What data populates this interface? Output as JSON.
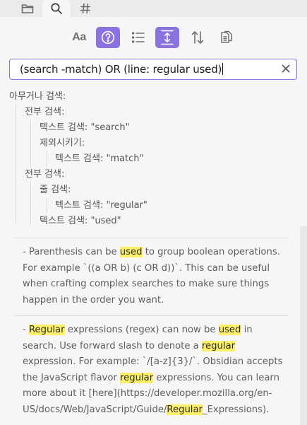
{
  "tabs": [
    {
      "icon": "folder-icon"
    },
    {
      "icon": "search-icon",
      "active": true
    },
    {
      "icon": "hashtag-icon"
    }
  ],
  "toolbar": {
    "case_label": "Aa",
    "buttons": [
      "match-case",
      "explain-query",
      "collapse-results",
      "show-more-context",
      "sort",
      "copy-results"
    ],
    "active_buttons": [
      "explain-query",
      "show-more-context"
    ]
  },
  "search": {
    "query": "(search -match)  OR (line: regular used)"
  },
  "explanation": {
    "root": "아무거나 검색:",
    "group1": "전부 검색:",
    "text_search": "텍스트 검색: \"search\"",
    "exclude": "제외시키기:",
    "text_match": "텍스트 검색: \"match\"",
    "group2": "전부 검색:",
    "line_search": "줄 검색:",
    "text_regular": "텍스트 검색: \"regular\"",
    "text_used": "텍스트 검색: \"used\""
  },
  "results": [
    {
      "text": "- Parenthesis can be used to group boolean operations. For example `((a OR b) (c OR d))`. This can be useful when crafting complex searches to make sure things happen in the order you want.",
      "highlights": [
        "used"
      ]
    },
    {
      "text": "- Regular expressions (regex) can now be used in search. Use forward slash to denote a regular expression. For example: `/[a-z]{3}/`. Obsidian accepts the JavaScript flavor regular expressions. You can learn more about it [here](https://developer.mozilla.org/en-US/docs/Web/JavaScript/Guide/Regular_Expressions).",
      "highlights": [
        "Regular",
        "used",
        "regular",
        "regular",
        "Regular"
      ]
    }
  ],
  "colors": {
    "accent": "#8a72e0",
    "highlight": "#fdf067",
    "background": "#f6f6f6"
  }
}
